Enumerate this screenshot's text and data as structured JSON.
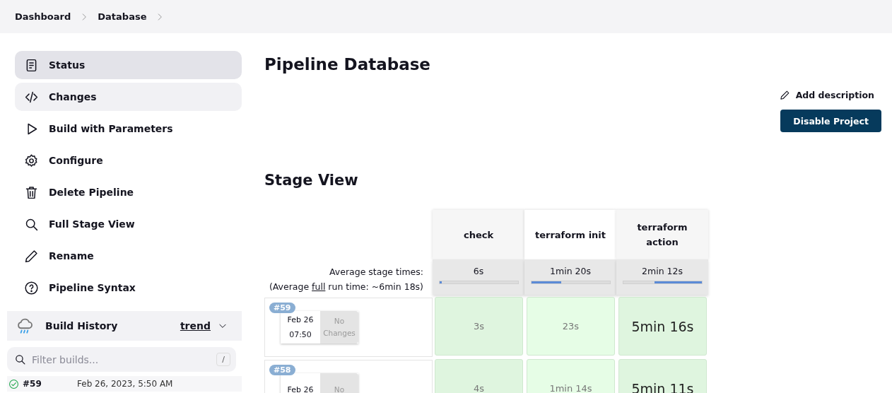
{
  "breadcrumbs": [
    {
      "label": "Dashboard"
    },
    {
      "label": "Database"
    }
  ],
  "sidebar": {
    "items": [
      {
        "label": "Status",
        "selected": true,
        "hovered": false
      },
      {
        "label": "Changes",
        "selected": false,
        "hovered": true
      },
      {
        "label": "Build with Parameters",
        "selected": false,
        "hovered": false
      },
      {
        "label": "Configure",
        "selected": false,
        "hovered": false
      },
      {
        "label": "Delete Pipeline",
        "selected": false,
        "hovered": false
      },
      {
        "label": "Full Stage View",
        "selected": false,
        "hovered": false
      },
      {
        "label": "Rename",
        "selected": false,
        "hovered": false
      },
      {
        "label": "Pipeline Syntax",
        "selected": false,
        "hovered": false
      }
    ]
  },
  "build_history": {
    "title": "Build History",
    "trend_link": "trend",
    "filter": {
      "placeholder": "Filter builds...",
      "shortcut": "/"
    },
    "builds": [
      {
        "number": "#59",
        "date": "Feb 26, 2023, 5:50 AM",
        "succeeded": true
      }
    ]
  },
  "main": {
    "title": "Pipeline Database",
    "add_description": "Add description",
    "disable_button": "Disable Project"
  },
  "stage_view": {
    "title": "Stage View",
    "average_label": "Average stage times:",
    "full_run": {
      "before": "(Average ",
      "link": "full",
      "after": " run time: ~6min 18s)"
    },
    "stages": [
      {
        "name": "check",
        "average": "6s",
        "level": 0.03,
        "right_aligned": false
      },
      {
        "name": "terraform init",
        "average": "1min 20s",
        "level": 0.38,
        "right_aligned": false
      },
      {
        "name": "terraform action",
        "average": "2min 12s",
        "level": 0.6,
        "right_aligned": true
      }
    ],
    "runs": [
      {
        "number": "#59",
        "date": "Feb 26",
        "time": "07:50",
        "changes": "No Changes",
        "cells": [
          {
            "duration": "3s",
            "long": false
          },
          {
            "duration": "23s",
            "long": false
          },
          {
            "duration": "5min 16s",
            "long": true
          }
        ]
      },
      {
        "number": "#58",
        "date": "Feb 26",
        "changes": "No",
        "cells": [
          {
            "duration": "4s",
            "long": false
          },
          {
            "duration": "1min 14s",
            "long": false
          },
          {
            "duration": "5min 11s",
            "long": true
          }
        ]
      }
    ]
  }
}
